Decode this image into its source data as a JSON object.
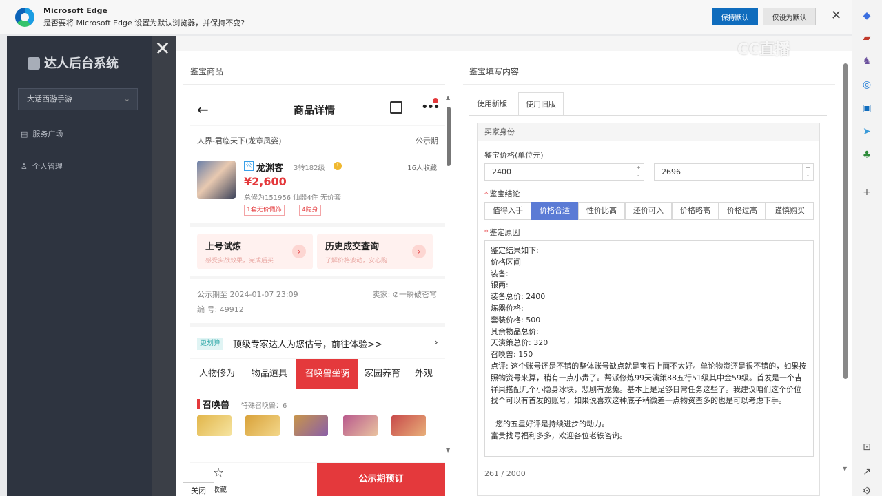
{
  "edge": {
    "title": "Microsoft Edge",
    "message": "是否要将 Microsoft Edge 设置为默认浏览器，并保持不变?",
    "keep_default": "保持默认",
    "only_default": "仅设为默认"
  },
  "admin": {
    "logo": "达人后台系统",
    "game_select": "大话西游手游",
    "nav": [
      "服务广场",
      "个人管理"
    ]
  },
  "drawer": {
    "left_title": "鉴宝商品",
    "right_title": "鉴宝填写内容",
    "close_label": "关闭"
  },
  "product": {
    "header_title": "商品详情",
    "server": "人界-君临天下(龙章凤姿)",
    "period": "公示期",
    "badge": "公",
    "name": "龙渊客",
    "level": "3转182级",
    "favorites": "16人收藏",
    "price": "¥2,600",
    "attrs": "总修为151956  仙器4件  无价套",
    "tags": [
      "1套无价佩饰",
      "4隐身"
    ],
    "trial_title": "上号试炼",
    "trial_sub": "感受实战效果，完成后买",
    "history_title": "历史成交查询",
    "history_sub": "了解价格波动，安心购",
    "period_end": "公示期至 2024-01-07 23:09",
    "seller": "卖家: ⊘一瞬破苍穹",
    "serial": "编 号: 49912",
    "promo_badge": "更划算",
    "promo_text": "顶级专家达人为您估号，前往体验>>",
    "tabs": [
      "人物修为",
      "物品道具",
      "召唤兽坐骑",
      "家园养育",
      "外观"
    ],
    "active_tab": 2,
    "pet_title": "召唤兽",
    "pet_count": "特殊召唤兽：6",
    "fav_label": "收藏",
    "order_label": "公示期预订"
  },
  "form": {
    "tabs": [
      "使用新版",
      "使用旧版"
    ],
    "active_tab": 1,
    "panel_title": "买家身份",
    "price_label": "鉴宝价格(单位元)",
    "price_min": "2400",
    "price_max": "2696",
    "conclusion_label": "鉴宝结论",
    "conclusions": [
      "值得入手",
      "价格合适",
      "性价比高",
      "还价可入",
      "价格略高",
      "价格过高",
      "谨慎购买"
    ],
    "active_conclusion": 1,
    "reason_label": "鉴定原因",
    "reason_text": "鉴定结果如下:\n价格区间\n装备:\n银两:\n装备总价: 2400\n炼器价格:\n套装价格: 500\n其余物品总价:\n天演策总价: 320\n召唤兽: 150\n点评: 这个账号还是不错的整体账号缺点就是宝石上面不太好。单论物资还是很不错的，如果按照物资号来算，稍有一点小贵了。帮派修炼99天演策88五行51级其中金59级。首发是一个吉祥果搭配几个小隐身冰块，悲剧有龙兔。基本上是足够日常任务这些了。我建议咱们这个价位找个可以有首发的账号，如果说喜欢这种底子稍微差一点物资蛮多的也是可以考虑下手。\n\n  您的五星好评是持续进步的动力。\n富贵找号福利多多，欢迎各位老铁咨询。",
    "counter": "261 / 2000"
  },
  "watermark": "CC直播"
}
